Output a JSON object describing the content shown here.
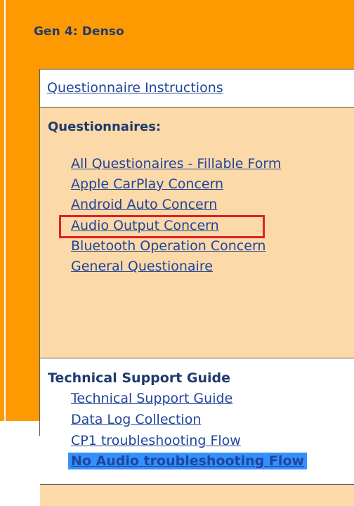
{
  "page": {
    "title": "Gen 4: Denso",
    "background_color": "#fd9a01"
  },
  "instructions": {
    "link": "Questionnaire Instructions"
  },
  "questionnaires": {
    "heading": "Questionnaires:",
    "links": [
      "All Questionaires - Fillable Form",
      "Apple CarPlay Concern",
      "Android Auto Concern",
      "Audio Output Concern",
      "Bluetooth Operation Concern",
      "General Questionaire"
    ],
    "highlighted_index": 3,
    "highlight_color": "#e02020"
  },
  "technical_support": {
    "heading": "Technical Support Guide",
    "links": [
      "Technical Support Guide",
      "Data Log Collection",
      "CP1 troubleshooting Flow",
      "No Audio troubleshooting Flow"
    ],
    "selected_index": 3,
    "selection_color": "#3390ff"
  }
}
